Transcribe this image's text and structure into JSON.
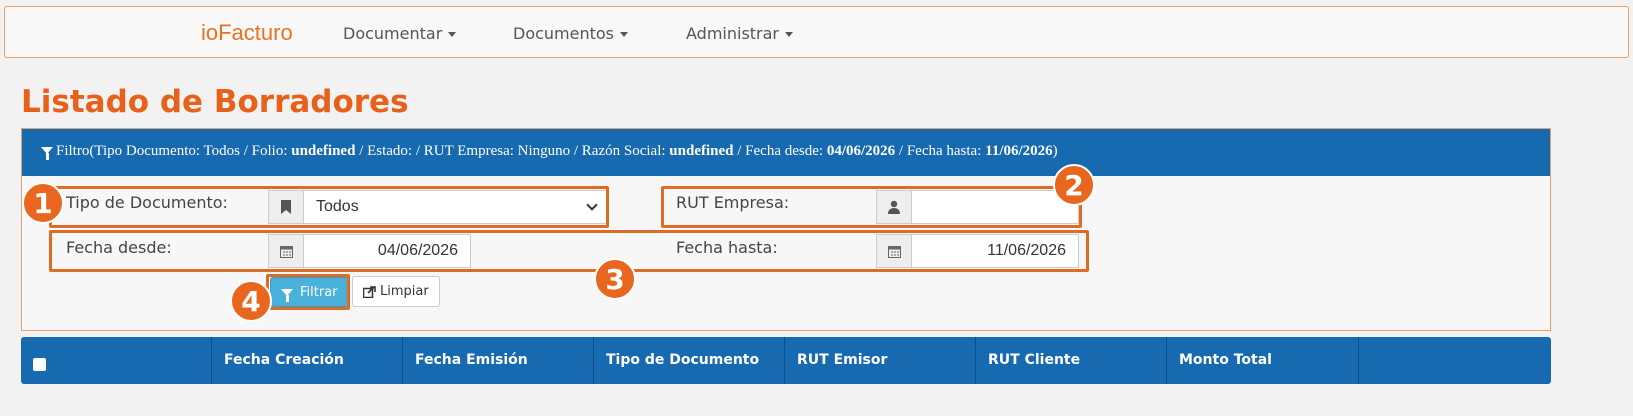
{
  "navbar": {
    "brand": "ioFacturo",
    "items": [
      {
        "label": "Documentar"
      },
      {
        "label": "Documentos"
      },
      {
        "label": "Administrar"
      }
    ]
  },
  "page": {
    "title": "Listado de Borradores"
  },
  "filter": {
    "heading_prefix": "Filtro(Tipo Documento: Todos / Folio: ",
    "folio": "undefined",
    "estado_text": " / Estado: / RUT Empresa: Ninguno / Razón Social: ",
    "razon_social": "undefined",
    "fecha_desde_text": " / Fecha desde: ",
    "fecha_desde_value": "04/06/2026",
    "fecha_hasta_text": " / Fecha hasta: ",
    "fecha_hasta_value": "11/06/2026",
    "close_paren": ")",
    "tipo_label": "Tipo de Documento:",
    "tipo_value": "Todos",
    "rut_label": "RUT Empresa:",
    "rut_value": "",
    "desde_label": "Fecha desde:",
    "desde_value": "04/06/2026",
    "hasta_label": "Fecha hasta:",
    "hasta_value": "11/06/2026",
    "filtrar_label": "Filtrar",
    "limpiar_label": "Limpiar"
  },
  "badges": [
    "1",
    "2",
    "3",
    "4"
  ],
  "table": {
    "columns": [
      "Fecha Creación",
      "Fecha Emisión",
      "Tipo de Documento",
      "RUT Emisor",
      "RUT Cliente",
      "Monto Total",
      ""
    ]
  },
  "colors": {
    "brand": "#e8721f",
    "primary": "#1769b0",
    "highlight": "#e06b25"
  }
}
